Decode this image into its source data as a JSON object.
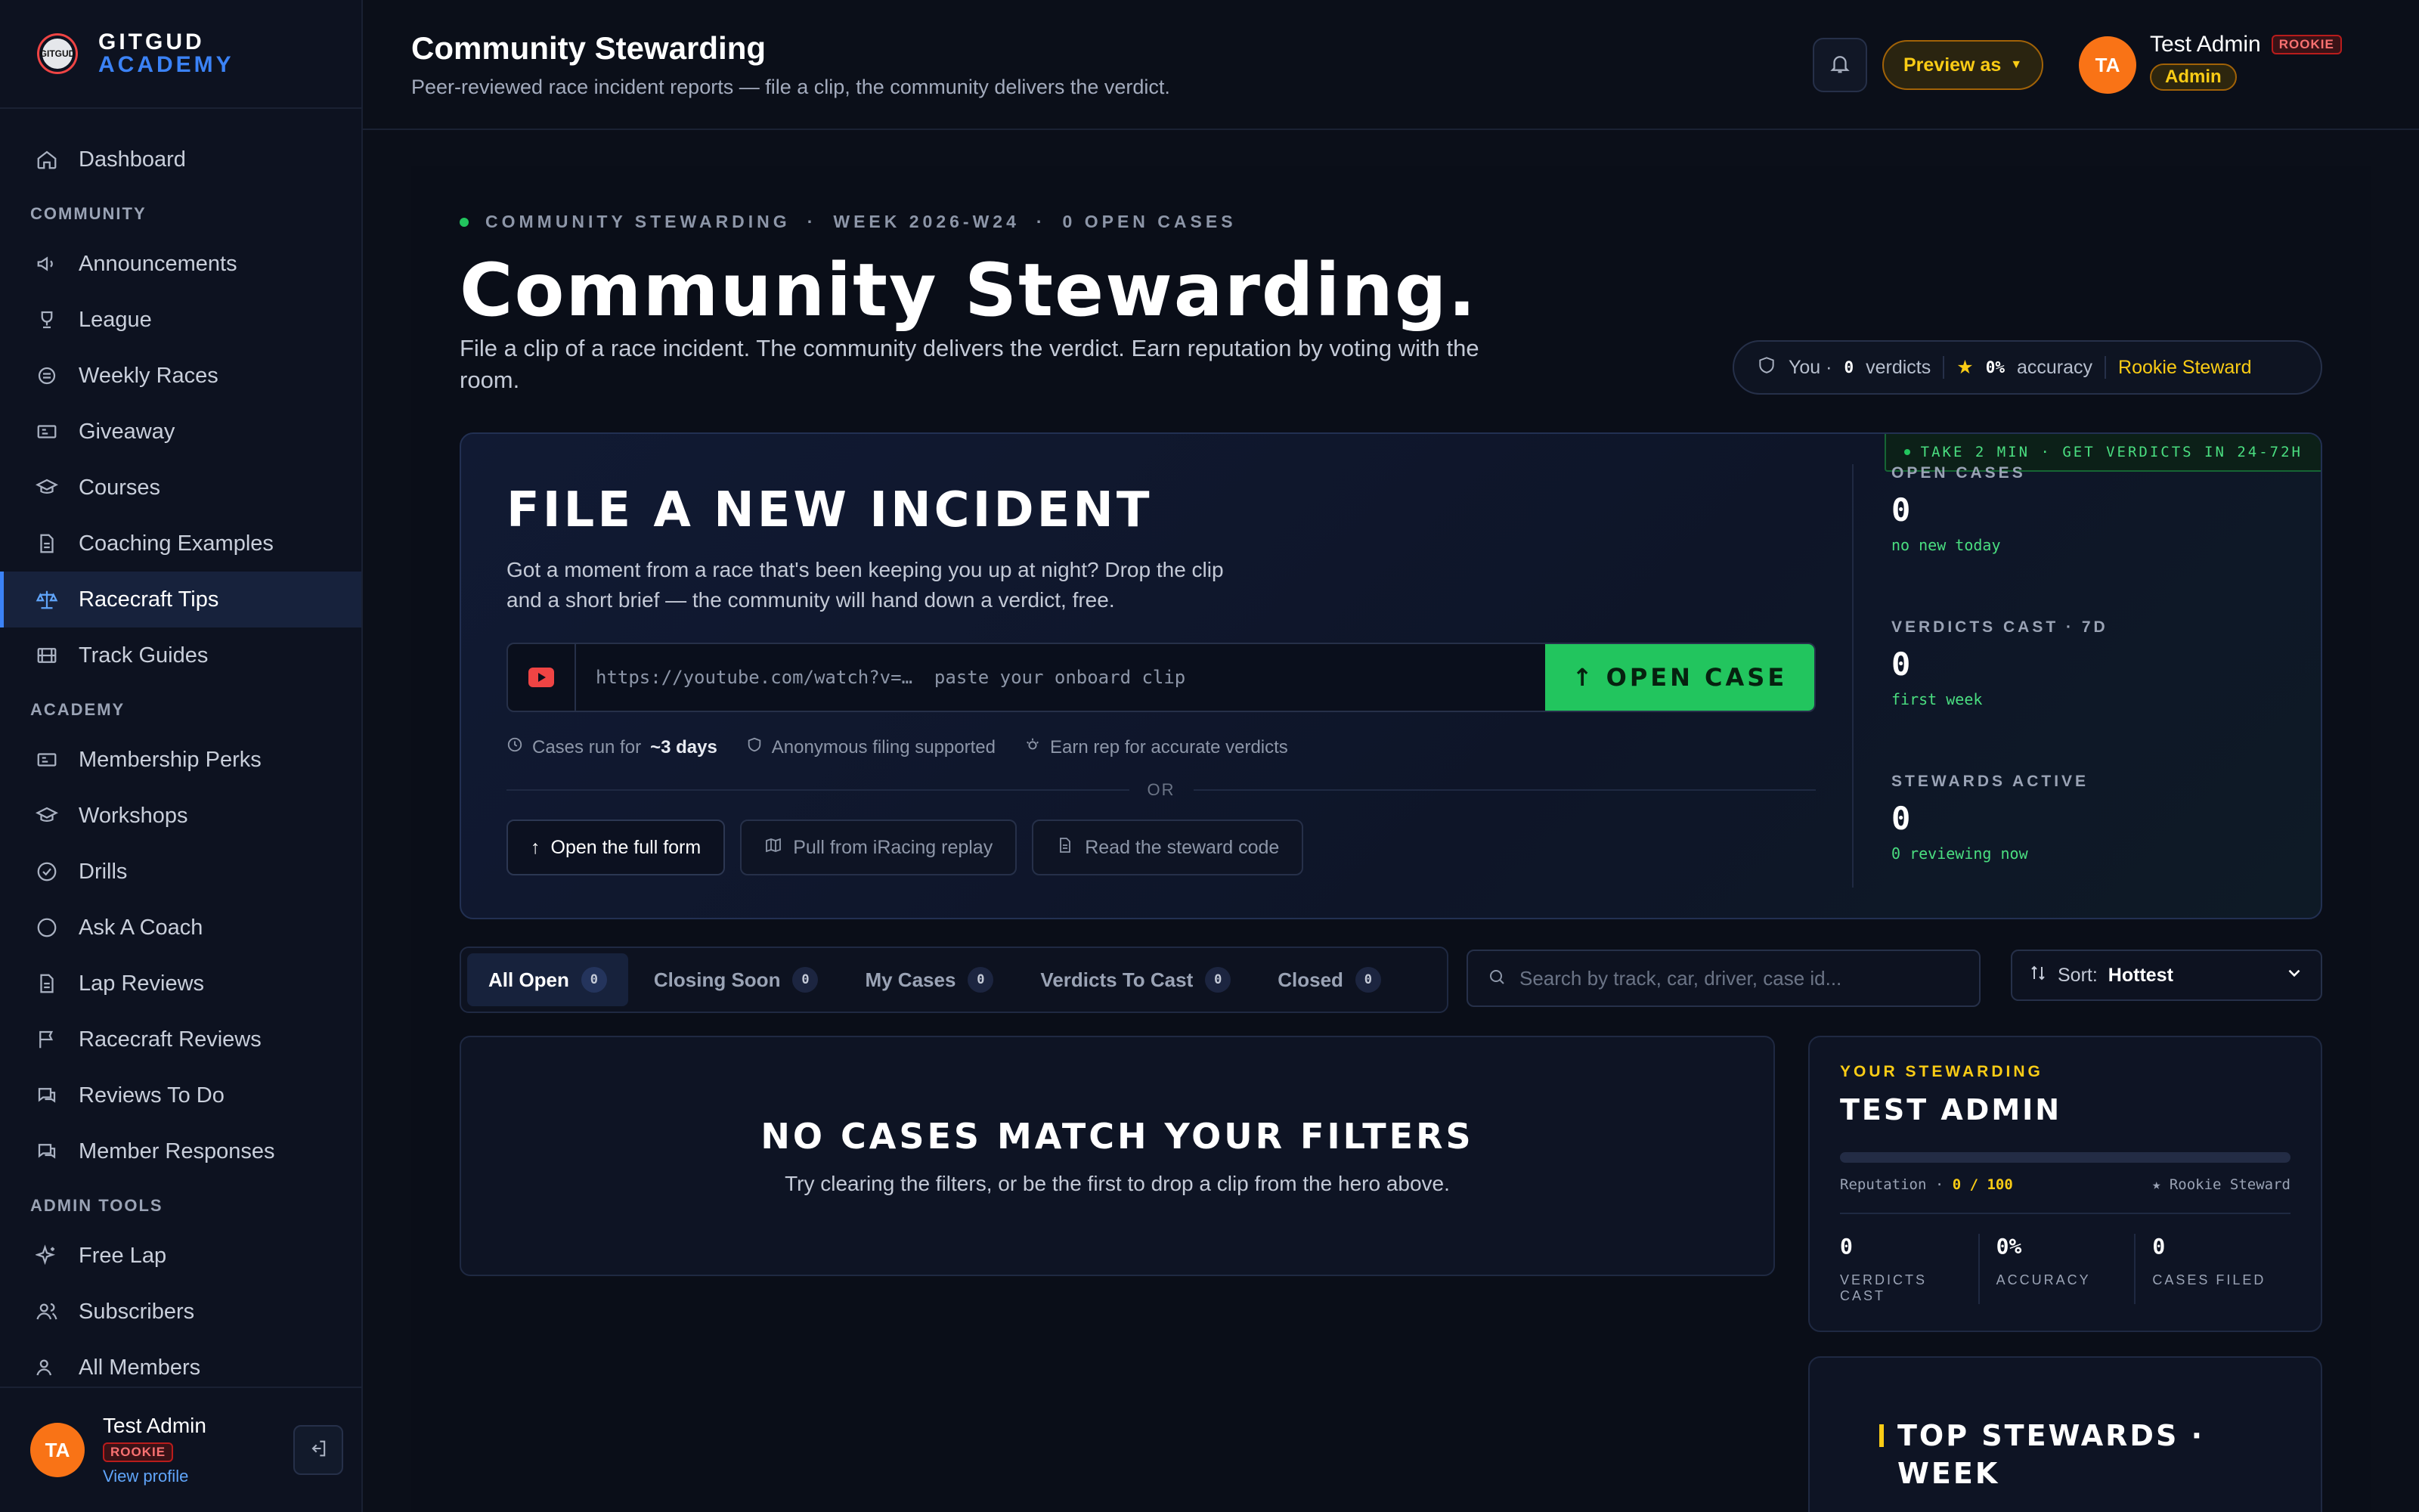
{
  "brand": {
    "line1": "GITGUD",
    "line2": "ACADEMY",
    "logo_text": "GITGUD"
  },
  "sidebar": {
    "top_items": [
      {
        "label": "Dashboard",
        "icon": "home-icon"
      }
    ],
    "sections": [
      {
        "title": "COMMUNITY",
        "items": [
          {
            "label": "Announcements",
            "icon": "megaphone-icon"
          },
          {
            "label": "League",
            "icon": "trophy-icon"
          },
          {
            "label": "Weekly Races",
            "icon": "flag-circle-icon"
          },
          {
            "label": "Giveaway",
            "icon": "ticket-icon"
          },
          {
            "label": "Courses",
            "icon": "graduation-cap-icon"
          },
          {
            "label": "Coaching Examples",
            "icon": "document-icon"
          },
          {
            "label": "Racecraft Tips",
            "icon": "scale-icon",
            "active": true
          },
          {
            "label": "Track Guides",
            "icon": "film-icon"
          }
        ]
      },
      {
        "title": "ACADEMY",
        "items": [
          {
            "label": "Membership Perks",
            "icon": "ticket-icon"
          },
          {
            "label": "Workshops",
            "icon": "graduation-cap-icon"
          },
          {
            "label": "Drills",
            "icon": "check-circle-icon"
          },
          {
            "label": "Ask A Coach",
            "icon": "chat-icon"
          },
          {
            "label": "Lap Reviews",
            "icon": "document-icon"
          },
          {
            "label": "Racecraft Reviews",
            "icon": "flag-icon"
          },
          {
            "label": "Reviews To Do",
            "icon": "chat-bubbles-icon"
          },
          {
            "label": "Member Responses",
            "icon": "chat-bubbles-icon"
          }
        ]
      },
      {
        "title": "ADMIN TOOLS",
        "items": [
          {
            "label": "Free Lap",
            "icon": "sparkles-icon"
          },
          {
            "label": "Subscribers",
            "icon": "users-icon"
          },
          {
            "label": "All Members",
            "icon": "users-icon"
          }
        ]
      }
    ],
    "footer": {
      "avatar": "TA",
      "name": "Test Admin",
      "badge": "ROOKIE",
      "link": "View profile"
    }
  },
  "topbar": {
    "title": "Community Stewarding",
    "subtitle": "Peer-reviewed race incident reports — file a clip, the community delivers the verdict.",
    "preview_label": "Preview as",
    "user": {
      "avatar": "TA",
      "name": "Test Admin",
      "badge": "ROOKIE",
      "role": "Admin"
    }
  },
  "hero": {
    "eyebrow": [
      "COMMUNITY STEWARDING",
      "WEEK 2026-W24",
      "0 OPEN CASES"
    ],
    "eyebrow_sep": "·",
    "title": "Community Stewarding.",
    "subtitle": "File a clip of a race incident. The community delivers the verdict. Earn reputation by voting with the room.",
    "you": {
      "prefix": "You ·",
      "verdicts_value": "0",
      "verdicts_label": "verdicts",
      "accuracy_value": "0%",
      "accuracy_label": "accuracy",
      "rank": "Rookie Steward"
    }
  },
  "file_card": {
    "title": "FILE A NEW INCIDENT",
    "description": "Got a moment from a race that's been keeping you up at night? Drop the clip and a short brief — the community will hand down a verdict, free.",
    "input_placeholder": "https://youtube.com/watch?v=…  paste your onboard clip",
    "submit_label": "OPEN CASE",
    "meta": {
      "runs_prefix": "Cases run for",
      "runs_value": "~3 days",
      "anonymous": "Anonymous filing supported",
      "rep": "Earn rep for accurate verdicts"
    },
    "or_label": "OR",
    "buttons": [
      "Open the full form",
      "Pull from iRacing replay",
      "Read the steward code"
    ],
    "badge": "TAKE 2 MIN · GET VERDICTS IN 24-72H",
    "stats": [
      {
        "label": "OPEN CASES",
        "value": "0",
        "note": "no new today"
      },
      {
        "label": "VERDICTS CAST · 7D",
        "value": "0",
        "note": "first week"
      },
      {
        "label": "STEWARDS ACTIVE",
        "value": "0",
        "note": "0 reviewing now"
      }
    ]
  },
  "filters": {
    "tabs": [
      {
        "label": "All Open",
        "count": "0",
        "active": true
      },
      {
        "label": "Closing Soon",
        "count": "0"
      },
      {
        "label": "My Cases",
        "count": "0"
      },
      {
        "label": "Verdicts To Cast",
        "count": "0"
      },
      {
        "label": "Closed",
        "count": "0"
      }
    ],
    "search_placeholder": "Search by track, car, driver, case id...",
    "sort_label": "Sort:",
    "sort_value": "Hottest"
  },
  "empty": {
    "title": "NO CASES MATCH YOUR FILTERS",
    "subtitle": "Try clearing the filters, or be the first to drop a clip from the hero above."
  },
  "your_stewarding": {
    "eyebrow": "YOUR STEWARDING",
    "name": "TEST ADMIN",
    "reputation_label": "Reputation ·",
    "reputation_value": "0 / 100",
    "reputation_fraction": 0,
    "rank": "★ Rookie Steward",
    "stats": [
      {
        "value": "0",
        "label": "VERDICTS CAST"
      },
      {
        "value": "0%",
        "label": "ACCURACY"
      },
      {
        "value": "0",
        "label": "CASES FILED"
      }
    ]
  },
  "top_stewards": {
    "title": "TOP STEWARDS · WEEK"
  },
  "colors": {
    "accent": "#3b82f6",
    "success": "#22c55e",
    "gold": "#facc15",
    "danger": "#ef4444",
    "avatar": "#f97316"
  }
}
